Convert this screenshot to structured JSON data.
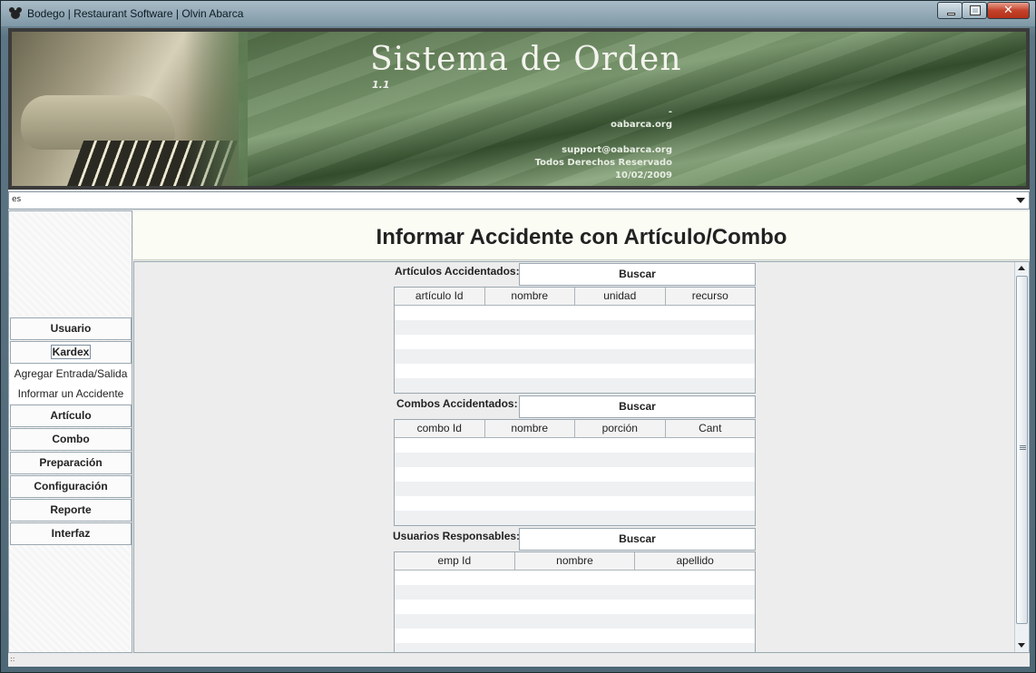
{
  "window": {
    "title": "Bodego | Restaurant Software | Olvin Abarca",
    "close_symbol": "✕"
  },
  "banner": {
    "title": "Sistema de Orden",
    "version": "1.1",
    "dash": "-",
    "site": "oabarca.org",
    "email": "support@oabarca.org",
    "rights": "Todos Derechos Reservado",
    "date": "10/02/2009"
  },
  "language": {
    "value": "es"
  },
  "sidebar": {
    "items": [
      {
        "label": "Usuario"
      },
      {
        "label": "Kardex"
      },
      {
        "label": "Agregar Entrada/Salida"
      },
      {
        "label": "Informar un Accidente"
      },
      {
        "label": "Artículo"
      },
      {
        "label": "Combo"
      },
      {
        "label": "Preparación"
      },
      {
        "label": "Configuración"
      },
      {
        "label": "Reporte"
      },
      {
        "label": "Interfaz"
      }
    ]
  },
  "page": {
    "title": "Informar Accidente con Artículo/Combo"
  },
  "sections": [
    {
      "label": "Artículos Accidentados:",
      "button": "Buscar",
      "columns": [
        "artículo Id",
        "nombre",
        "unidad",
        "recurso"
      ]
    },
    {
      "label": "Combos Accidentados:",
      "button": "Buscar",
      "columns": [
        "combo Id",
        "nombre",
        "porción",
        "Cant"
      ]
    },
    {
      "label": "Usuarios Responsables:",
      "button": "Buscar",
      "columns": [
        "emp Id",
        "nombre",
        "apellido"
      ]
    }
  ],
  "statusbar": {
    "grip": "::"
  },
  "colors": {
    "banner_green": "#5f7d55",
    "header_bg": "#fbfdf5",
    "frame": "#5d7685"
  }
}
